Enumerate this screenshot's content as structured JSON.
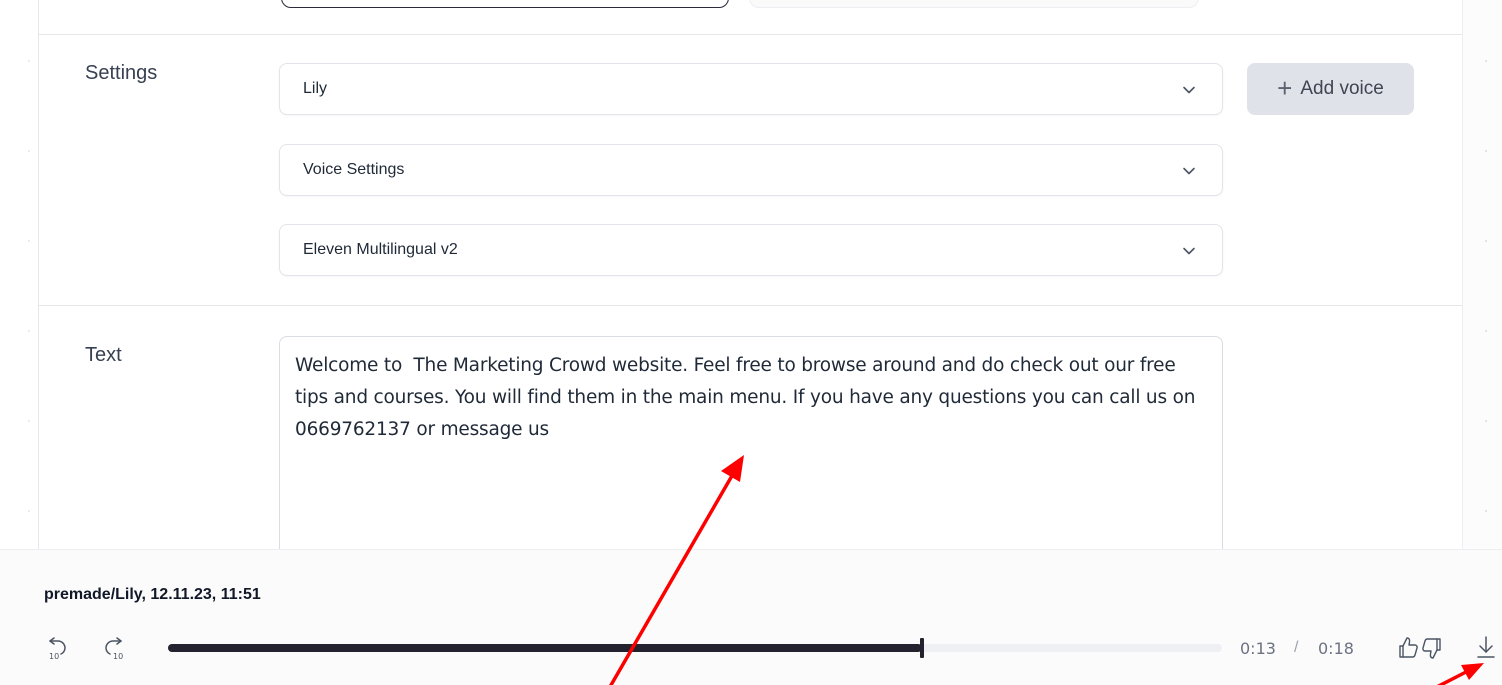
{
  "settings": {
    "label": "Settings",
    "voice_select": "Lily",
    "voice_settings_select": "Voice Settings",
    "model_select": "Eleven Multilingual v2",
    "add_voice_label": "Add voice"
  },
  "text_section": {
    "label": "Text",
    "content": "Welcome to  The Marketing Crowd website. Feel free to browse around and do check out our free tips and courses. You will find them in the main menu. If you have any questions you can call us on 0669762137 or message us"
  },
  "player": {
    "title": "premade/Lily, 12.11.23, 11:51",
    "current_time": "0:13",
    "time_separator": "/",
    "total_time": "0:18",
    "progress_fraction": 0.715
  },
  "colors": {
    "accent_dark": "#23222e",
    "annotation_red": "#ff0000",
    "button_bg": "#dfe2e8"
  },
  "icons": {
    "rewind": "rewind-10-icon",
    "forward": "forward-10-icon",
    "like": "thumbs-up-icon",
    "dislike": "thumbs-down-icon",
    "download": "download-icon",
    "chevron": "chevron-down-icon"
  }
}
